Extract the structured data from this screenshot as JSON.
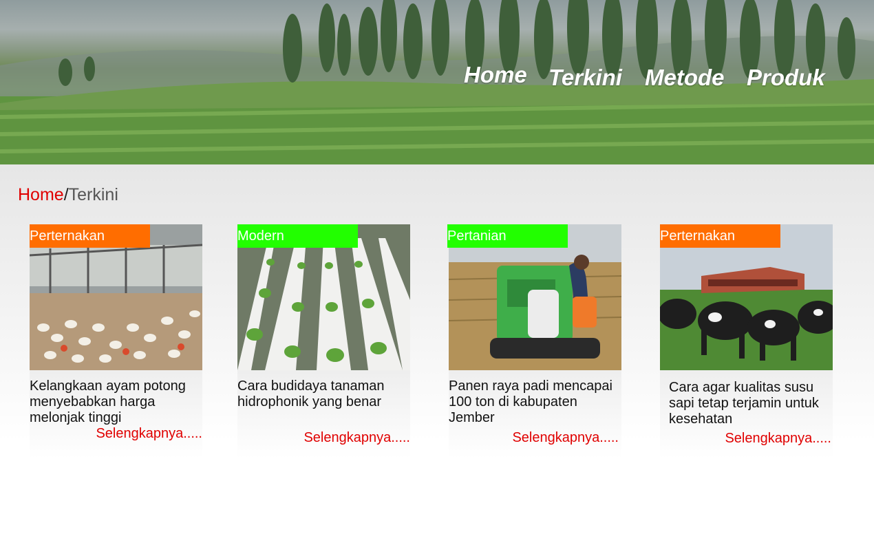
{
  "nav": {
    "items": [
      "Home",
      "Terkini",
      "Metode",
      "Produk"
    ]
  },
  "breadcrumb": {
    "home": "Home",
    "separator": "/",
    "current": "Terkini"
  },
  "cards": [
    {
      "tag": "Perternakan",
      "tag_color": "#ff6d00",
      "title": "Kelangkaan ayam potong menyebabkan harga melonjak tinggi",
      "more": "Selengkapnya....."
    },
    {
      "tag": "Modern",
      "tag_color": "#22ff00",
      "title": "Cara budidaya tanaman hidrophonik yang benar",
      "more": "Selengkapnya....."
    },
    {
      "tag": "Pertanian",
      "tag_color": "#22ff00",
      "title": "Panen raya padi mencapai 100 ton di kabupaten Jember",
      "more": "Selengkapnya....."
    },
    {
      "tag": "Perternakan",
      "tag_color": "#ff6d00",
      "title": "Cara agar kualitas susu sapi tetap terjamin untuk kesehatan",
      "more": "Selengkapnya....."
    }
  ]
}
